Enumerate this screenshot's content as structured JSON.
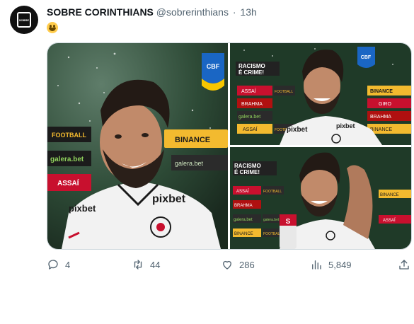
{
  "tweet": {
    "display_name": "SOBRE CORINTHIANS",
    "handle": "@sobrerinthians",
    "separator": "·",
    "time": "13h",
    "text_emoji": "grinning-face-with-smiling-eyes"
  },
  "avatar_logo_text": "SOBRE",
  "photos": {
    "photo1": {
      "board_labels": [
        "FOOTBALL",
        "BINANCE",
        "galera.bet",
        "galera.bet",
        "ASSAÍ",
        "FOOTBALL"
      ],
      "shirt_sponsor": "pixbet",
      "cbf_text": "CBF"
    },
    "photo2": {
      "banner": [
        "RACISMO",
        "É CRIME!"
      ],
      "board_labels": [
        "ASSAÍ",
        "FOOTBALL",
        "BINANCE",
        "GIRO",
        "BRAHMA",
        "galera.bet",
        "BRAHMA",
        "FOOTBALL",
        "ASSAÍ",
        "BINANCE"
      ],
      "shirt_sponsor": "pixbet",
      "cbf_text": "CBF"
    },
    "photo3": {
      "banner": [
        "RACISMO",
        "É CRIME!"
      ],
      "board_labels": [
        "ASSAÍ",
        "FOOTBALL",
        "BRAHMA",
        "galera.bet",
        "galera.bet",
        "ASSAÍ",
        "BINANCE",
        "FOOTBALL",
        "ASSAÍ",
        "BINANCE"
      ],
      "mic_label": "S"
    }
  },
  "actions": {
    "replies": "4",
    "retweets": "44",
    "likes": "286",
    "views": "5,849"
  },
  "colors": {
    "accent_text": "#0f1419",
    "muted": "#536471",
    "stadium_green": "#1f5a2a",
    "board_yellow": "#f3ba2f",
    "board_red": "#c8102e"
  }
}
